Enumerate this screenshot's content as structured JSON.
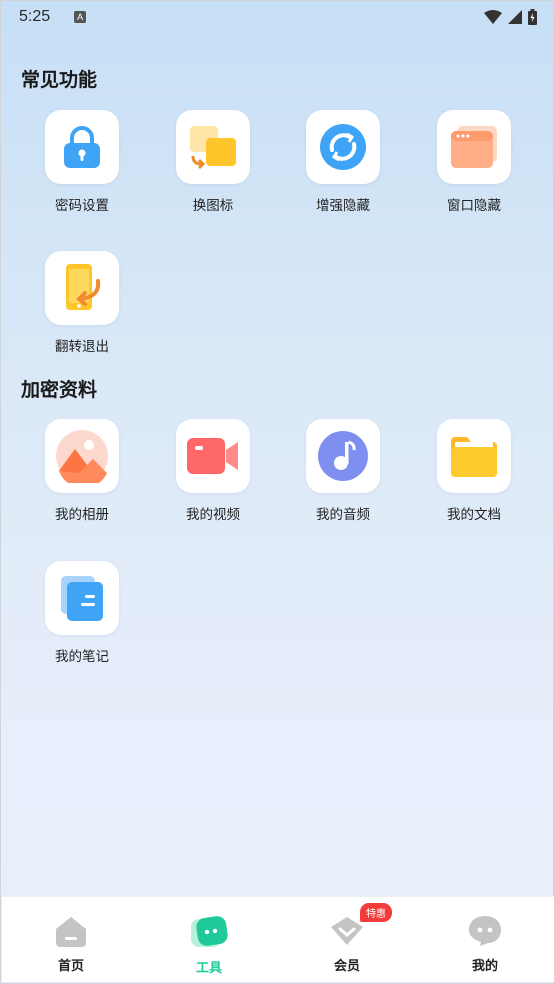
{
  "status_bar": {
    "time": "5:25",
    "notification_letter": "A"
  },
  "sections": [
    {
      "title": "常见功能"
    },
    {
      "title": "加密资料"
    }
  ],
  "common_tools": [
    {
      "label": "密码设置",
      "icon": "lock-icon"
    },
    {
      "label": "换图标",
      "icon": "swap-icon"
    },
    {
      "label": "增强隐藏",
      "icon": "sync-icon"
    },
    {
      "label": "窗口隐藏",
      "icon": "window-icon"
    },
    {
      "label": "翻转退出",
      "icon": "phone-flip-icon"
    }
  ],
  "encrypted_items": [
    {
      "label": "我的相册",
      "icon": "album-icon"
    },
    {
      "label": "我的视频",
      "icon": "video-camera-icon"
    },
    {
      "label": "我的音频",
      "icon": "music-note-icon"
    },
    {
      "label": "我的文档",
      "icon": "folder-icon"
    },
    {
      "label": "我的笔记",
      "icon": "note-icon"
    }
  ],
  "tabbar": {
    "items": [
      {
        "label": "首页",
        "icon": "home-icon"
      },
      {
        "label": "工具",
        "icon": "tools-icon",
        "active": true
      },
      {
        "label": "会员",
        "icon": "member-icon",
        "badge": "特惠"
      },
      {
        "label": "我的",
        "icon": "profile-icon"
      }
    ]
  },
  "colors": {
    "accent": "#1fc99a",
    "badge": "#f23c3c",
    "icon_blue": "#3fa4f5",
    "icon_yellow": "#ffc62b"
  }
}
